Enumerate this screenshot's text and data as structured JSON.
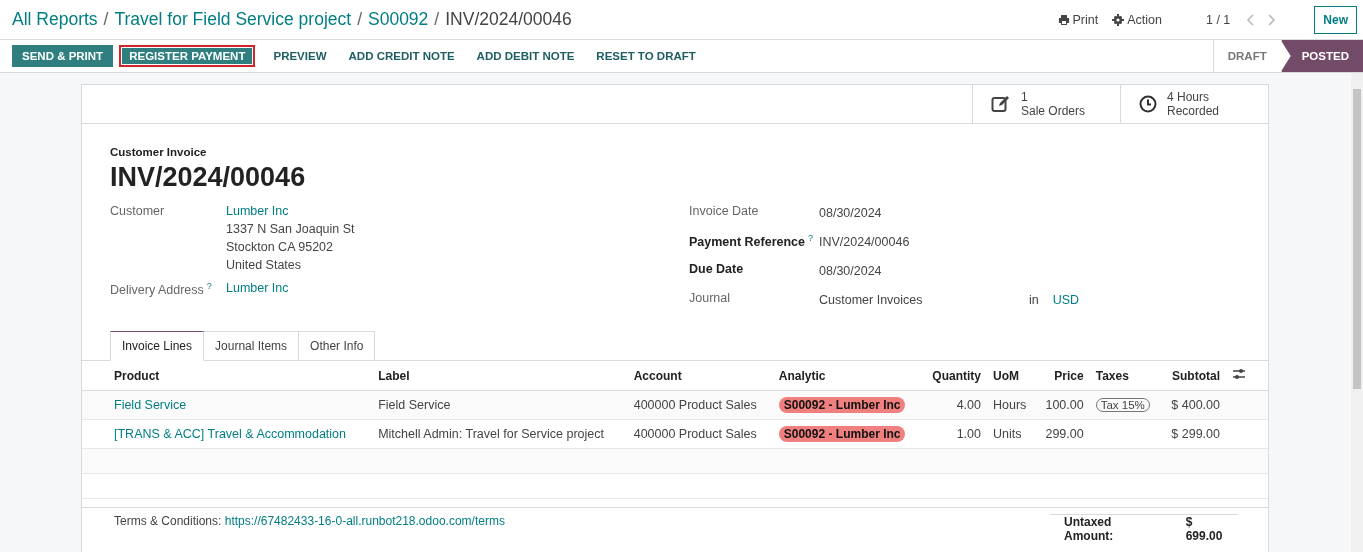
{
  "breadcrumbs": [
    {
      "label": "All Reports",
      "current": false
    },
    {
      "separator": "/",
      "label": "Travel for Field Service project",
      "current": false
    },
    {
      "separator": "/",
      "label": "S00092",
      "current": false
    },
    {
      "separator": "/",
      "label": "INV/2024/00046",
      "current": true
    }
  ],
  "top_actions": {
    "print": "Print",
    "action": "Action",
    "pager": "1 / 1",
    "new": "New"
  },
  "action_buttons": [
    {
      "label": "SEND & PRINT",
      "kind": "primary",
      "highlighted": false
    },
    {
      "label": "REGISTER PAYMENT",
      "kind": "primary",
      "highlighted": true
    },
    {
      "label": "PREVIEW",
      "kind": "link",
      "highlighted": false
    },
    {
      "label": "ADD CREDIT NOTE",
      "kind": "link",
      "highlighted": false
    },
    {
      "label": "ADD DEBIT NOTE",
      "kind": "link",
      "highlighted": false
    },
    {
      "label": "RESET TO DRAFT",
      "kind": "link",
      "highlighted": false
    }
  ],
  "status_steps": [
    {
      "label": "DRAFT",
      "selected": false
    },
    {
      "label": "POSTED",
      "selected": true
    }
  ],
  "smart_buttons": [
    {
      "kind": "edit",
      "value": "1",
      "label": "Sale Orders"
    },
    {
      "kind": "clock",
      "value": "4 Hours",
      "label": "Recorded"
    }
  ],
  "form": {
    "type_label": "Customer Invoice",
    "number": "INV/2024/00046",
    "left_fields": [
      {
        "label": "Customer",
        "value": "Lumber Inc",
        "address": [
          "1337 N San Joaquin St",
          "Stockton CA 95202",
          "United States"
        ]
      },
      {
        "label": "Delivery Address",
        "help_mark": "?",
        "value": "Lumber Inc"
      }
    ],
    "right_fields": [
      {
        "label": "Invoice Date",
        "required": false,
        "value": "08/30/2024"
      },
      {
        "label": "Payment Reference",
        "required": true,
        "help_mark": "?",
        "value": "INV/2024/00046"
      },
      {
        "label": "Due Date",
        "required": true,
        "value": "08/30/2024"
      },
      {
        "label": "Journal",
        "required": false,
        "value": "Customer Invoices",
        "suffix": "in",
        "currency": "USD"
      }
    ]
  },
  "tabs": [
    {
      "label": "Invoice Lines",
      "selected": true
    },
    {
      "label": "Journal Items",
      "selected": false
    },
    {
      "label": "Other Info",
      "selected": false
    }
  ],
  "table": {
    "columns": [
      "Product",
      "Label",
      "Account",
      "Analytic",
      "Quantity",
      "UoM",
      "Price",
      "Taxes",
      "Subtotal"
    ],
    "rows": [
      {
        "product": "Field Service",
        "label": "Field Service",
        "account": "400000 Product Sales",
        "analytic": "S00092 - Lumber Inc",
        "quantity": "4.00",
        "uom": "Hours",
        "price": "100.00",
        "taxes": "Tax 15%",
        "subtotal": "$ 400.00"
      },
      {
        "product": "[TRANS & ACC] Travel & Accommodation",
        "label": "Mitchell Admin: Travel for Service project",
        "account": "400000 Product Sales",
        "analytic": "S00092 - Lumber Inc",
        "quantity": "1.00",
        "uom": "Units",
        "price": "299.00",
        "subtotal": "$ 299.00"
      }
    ]
  },
  "footer": {
    "terms_label": "Terms & Conditions:",
    "terms_link": "https://67482433-16-0-all.runbot218.odoo.com/terms",
    "untaxed_label": "Untaxed Amount:",
    "untaxed_value": "$ 699.00"
  }
}
